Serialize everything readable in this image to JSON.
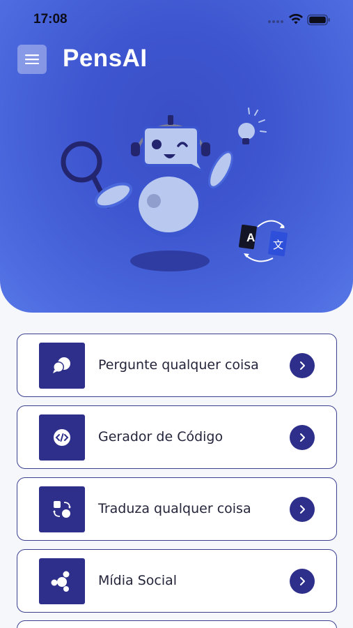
{
  "status_bar": {
    "time": "17:08"
  },
  "header": {
    "title": "PensAI",
    "menu_icon": "hamburger-icon"
  },
  "illustration": {
    "subject": "robot-assistant-illustration"
  },
  "menu": {
    "items": [
      {
        "label": "Pergunte qualquer coisa",
        "icon": "chat-bubbles-icon"
      },
      {
        "label": "Gerador de Código",
        "icon": "code-icon"
      },
      {
        "label": "Traduza qualquer coisa",
        "icon": "translate-icon"
      },
      {
        "label": "Mídia Social",
        "icon": "share-icon"
      }
    ]
  },
  "colors": {
    "hero": "#4a66db",
    "accent": "#2e2f8a",
    "card_border": "#3a3f8f",
    "background": "#f6f7fb"
  }
}
